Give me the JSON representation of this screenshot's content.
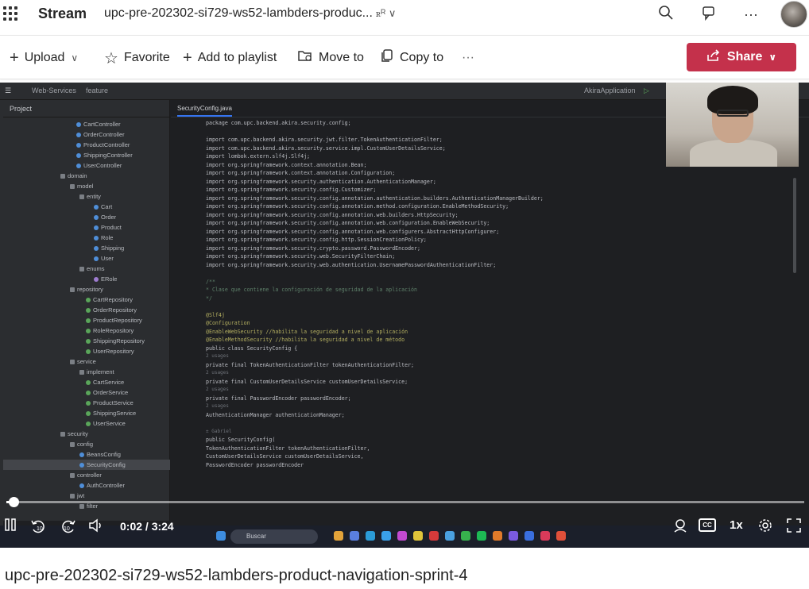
{
  "header": {
    "app_name": "Stream",
    "video_title": "upc-pre-202302-si729-ws52-lambders-produc...",
    "shared_icon_label": "ꭱᴿ ∨"
  },
  "commands": {
    "upload": "Upload",
    "favorite": "Favorite",
    "add_to_playlist": "Add to playlist",
    "move_to": "Move to",
    "copy_to": "Copy to",
    "more": "···",
    "share": "Share"
  },
  "ide": {
    "project_label": "Project",
    "file_tab": "SecurityConfig.java",
    "top_left": "Web-Services",
    "top_branch": "feature",
    "run_config": "AkiraApplication",
    "tree": [
      {
        "label": "CartController",
        "kind": "c",
        "indent": 92
      },
      {
        "label": "OrderController",
        "kind": "c",
        "indent": 92
      },
      {
        "label": "ProductController",
        "kind": "c",
        "indent": 92
      },
      {
        "label": "ShippingController",
        "kind": "c",
        "indent": 92
      },
      {
        "label": "UserController",
        "kind": "c",
        "indent": 92
      },
      {
        "label": "domain",
        "kind": "f",
        "indent": 72
      },
      {
        "label": "model",
        "kind": "f",
        "indent": 84
      },
      {
        "label": "entity",
        "kind": "f",
        "indent": 96
      },
      {
        "label": "Cart",
        "kind": "c",
        "indent": 114
      },
      {
        "label": "Order",
        "kind": "c",
        "indent": 114
      },
      {
        "label": "Product",
        "kind": "c",
        "indent": 114
      },
      {
        "label": "Role",
        "kind": "c",
        "indent": 114
      },
      {
        "label": "Shipping",
        "kind": "c",
        "indent": 114
      },
      {
        "label": "User",
        "kind": "c",
        "indent": 114
      },
      {
        "label": "enums",
        "kind": "f",
        "indent": 96
      },
      {
        "label": "ERole",
        "kind": "e",
        "indent": 114
      },
      {
        "label": "repository",
        "kind": "f",
        "indent": 84
      },
      {
        "label": "CartRepository",
        "kind": "i",
        "indent": 104
      },
      {
        "label": "OrderRepository",
        "kind": "i",
        "indent": 104
      },
      {
        "label": "ProductRepository",
        "kind": "i",
        "indent": 104
      },
      {
        "label": "RoleRepository",
        "kind": "i",
        "indent": 104
      },
      {
        "label": "ShippingRepository",
        "kind": "i",
        "indent": 104
      },
      {
        "label": "UserRepository",
        "kind": "i",
        "indent": 104
      },
      {
        "label": "service",
        "kind": "f",
        "indent": 84
      },
      {
        "label": "implement",
        "kind": "f",
        "indent": 96
      },
      {
        "label": "CartService",
        "kind": "i",
        "indent": 104
      },
      {
        "label": "OrderService",
        "kind": "i",
        "indent": 104
      },
      {
        "label": "ProductService",
        "kind": "i",
        "indent": 104
      },
      {
        "label": "ShippingService",
        "kind": "i",
        "indent": 104
      },
      {
        "label": "UserService",
        "kind": "i",
        "indent": 104
      },
      {
        "label": "security",
        "kind": "f",
        "indent": 72
      },
      {
        "label": "config",
        "kind": "f",
        "indent": 84
      },
      {
        "label": "BeansConfig",
        "kind": "c",
        "indent": 96
      },
      {
        "label": "SecurityConfig",
        "kind": "c",
        "indent": 96,
        "selected": true
      },
      {
        "label": "controller",
        "kind": "f",
        "indent": 84
      },
      {
        "label": "AuthController",
        "kind": "c",
        "indent": 96
      },
      {
        "label": "jwt",
        "kind": "f",
        "indent": 84
      },
      {
        "label": "filter",
        "kind": "f",
        "indent": 96
      }
    ],
    "code": [
      {
        "t": "package com.upc.backend.akira.security.config;",
        "c": ""
      },
      {
        "t": "",
        "c": ""
      },
      {
        "t": "import com.upc.backend.akira.security.jwt.filter.TokenAuthenticationFilter;",
        "c": ""
      },
      {
        "t": "import com.upc.backend.akira.security.service.impl.CustomUserDetailsService;",
        "c": ""
      },
      {
        "t": "import lombok.extern.slf4j.Slf4j;",
        "c": ""
      },
      {
        "t": "import org.springframework.context.annotation.Bean;",
        "c": ""
      },
      {
        "t": "import org.springframework.context.annotation.Configuration;",
        "c": ""
      },
      {
        "t": "import org.springframework.security.authentication.AuthenticationManager;",
        "c": ""
      },
      {
        "t": "import org.springframework.security.config.Customizer;",
        "c": ""
      },
      {
        "t": "import org.springframework.security.config.annotation.authentication.builders.AuthenticationManagerBuilder;",
        "c": ""
      },
      {
        "t": "import org.springframework.security.config.annotation.method.configuration.EnableMethodSecurity;",
        "c": ""
      },
      {
        "t": "import org.springframework.security.config.annotation.web.builders.HttpSecurity;",
        "c": ""
      },
      {
        "t": "import org.springframework.security.config.annotation.web.configuration.EnableWebSecurity;",
        "c": ""
      },
      {
        "t": "import org.springframework.security.config.annotation.web.configurers.AbstractHttpConfigurer;",
        "c": ""
      },
      {
        "t": "import org.springframework.security.config.http.SessionCreationPolicy;",
        "c": ""
      },
      {
        "t": "import org.springframework.security.crypto.password.PasswordEncoder;",
        "c": ""
      },
      {
        "t": "import org.springframework.security.web.SecurityFilterChain;",
        "c": ""
      },
      {
        "t": "import org.springframework.security.web.authentication.UsernamePasswordAuthenticationFilter;",
        "c": ""
      },
      {
        "t": "",
        "c": ""
      },
      {
        "t": "/**",
        "c": "cm"
      },
      {
        "t": " * Clase que contiene la configuración de seguridad de la aplicación",
        "c": "cm"
      },
      {
        "t": " */",
        "c": "cm"
      },
      {
        "t": "",
        "c": ""
      },
      {
        "t": "@Slf4j",
        "c": "an"
      },
      {
        "t": "@Configuration",
        "c": "an"
      },
      {
        "t": "@EnableWebSecurity //habilita la seguridad a nivel de aplicación",
        "c": "an"
      },
      {
        "t": "@EnableMethodSecurity //habilita la seguridad a nivel de método",
        "c": "an"
      },
      {
        "t": "public class SecurityConfig {",
        "c": ""
      },
      {
        "t": "    2 usages",
        "c": "hint"
      },
      {
        "t": "    private final TokenAuthenticationFilter tokenAuthenticationFilter;",
        "c": ""
      },
      {
        "t": "    2 usages",
        "c": "hint"
      },
      {
        "t": "    private final CustomUserDetailsService customUserDetailsService;",
        "c": ""
      },
      {
        "t": "    2 usages",
        "c": "hint"
      },
      {
        "t": "    private final PasswordEncoder passwordEncoder;",
        "c": ""
      },
      {
        "t": "    2 usages",
        "c": "hint"
      },
      {
        "t": "    AuthenticationManager authenticationManager;",
        "c": ""
      },
      {
        "t": "",
        "c": ""
      },
      {
        "t": "    ± Gabriel",
        "c": "hint"
      },
      {
        "t": "    public SecurityConfig(",
        "c": ""
      },
      {
        "t": "            TokenAuthenticationFilter tokenAuthenticationFilter,",
        "c": ""
      },
      {
        "t": "            CustomUserDetailsService customUserDetailsService,",
        "c": ""
      },
      {
        "t": "            PasswordEncoder passwordEncoder",
        "c": ""
      }
    ],
    "taskbar_search": "Buscar"
  },
  "player": {
    "current_time": "0:02",
    "duration": "3:24",
    "time_display": "0:02 / 3:24",
    "progress_fraction": 0.01,
    "skip_back": "10",
    "skip_forward": "10",
    "cc_label": "CC",
    "speed": "1x"
  },
  "page_title": "upc-pre-202302-si729-ws52-lambders-product-navigation-sprint-4",
  "colors": {
    "share_button": "#c4314b",
    "ide_background": "#1e1f22",
    "ide_panel": "#2b2d30"
  }
}
